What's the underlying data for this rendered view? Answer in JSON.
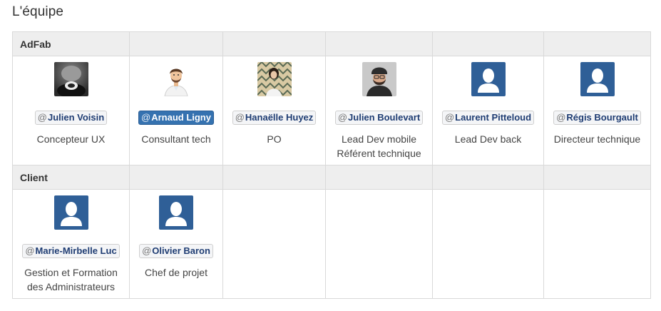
{
  "page": {
    "title": "L'équipe"
  },
  "groups": [
    {
      "label": "AdFab",
      "members": [
        {
          "name": "Julien Voisin",
          "role_lines": [
            "Concepteur UX"
          ],
          "avatar": "photo-dark"
        },
        {
          "name": "Arnaud Ligny",
          "role_lines": [
            "Consultant tech"
          ],
          "avatar": "cartoon",
          "active": true
        },
        {
          "name": "Hanaëlle Huyez",
          "role_lines": [
            "PO"
          ],
          "avatar": "photo-pattern"
        },
        {
          "name": "Julien Boulevart",
          "role_lines": [
            "Lead Dev mobile",
            "Référent technique"
          ],
          "avatar": "photo-cap"
        },
        {
          "name": "Laurent Pitteloud",
          "role_lines": [
            "Lead Dev back"
          ],
          "avatar": "default"
        },
        {
          "name": "Régis Bourgault",
          "role_lines": [
            "Directeur technique"
          ],
          "avatar": "default"
        }
      ]
    },
    {
      "label": "Client",
      "members": [
        {
          "name": "Marie-Mirbelle Luc",
          "role_lines": [
            "Gestion et Formation",
            "des Administrateurs"
          ],
          "avatar": "default"
        },
        {
          "name": "Olivier Baron",
          "role_lines": [
            "Chef de projet"
          ],
          "avatar": "default"
        }
      ]
    }
  ],
  "mention_prefix": "@",
  "colors": {
    "default_avatar": "#2f5f97",
    "mention_active": "#3572b0",
    "header_bg": "#eeeeee"
  }
}
